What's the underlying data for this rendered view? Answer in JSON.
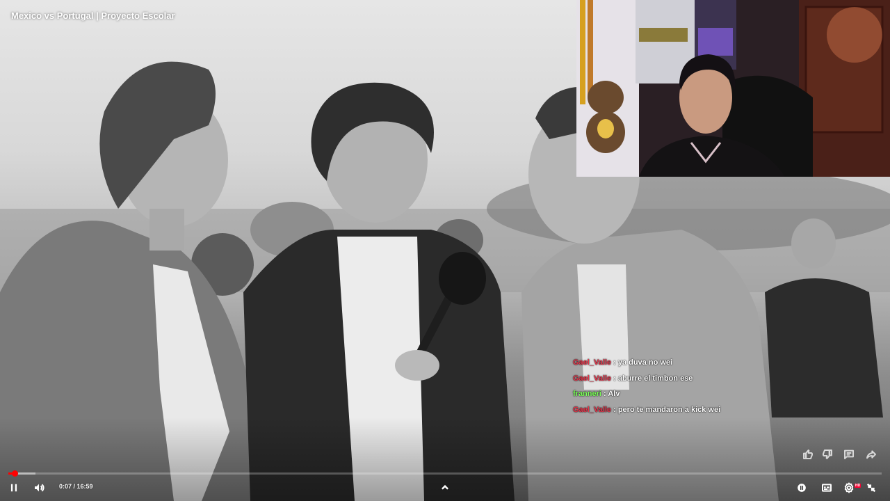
{
  "video": {
    "title": "Mexico vs Portugal | Proyecto Escolar"
  },
  "chat": {
    "messages": [
      {
        "user": "Gael_Valle",
        "text": "ya duva no wei",
        "color": "#e8344a"
      },
      {
        "user": "Gael_Valle",
        "text": "aburre el timbon ese",
        "color": "#e8344a"
      },
      {
        "user": "franneri",
        "text": "Alv",
        "color": "#7dff5a"
      },
      {
        "user": "Gael_Valle",
        "text": "pero te mandaron a kick wei",
        "color": "#e8344a"
      }
    ]
  },
  "player": {
    "current_time": "0:07",
    "duration": "16:59",
    "time_separator": " / ",
    "progress_fraction": 0.0069,
    "buffer_fraction": 0.031,
    "state": "playing",
    "accent_color": "#ff0000",
    "quality_badge": "HD"
  },
  "icons": {
    "play_pause": "pause-icon",
    "volume": "volume-icon",
    "expand": "chevron-up-icon",
    "autoplay": "autoplay-toggle-icon",
    "subtitles": "subtitles-icon",
    "settings": "gear-icon",
    "fullscreen": "exit-fullscreen-icon",
    "like": "thumbs-up-icon",
    "dislike": "thumbs-down-icon",
    "comments": "comment-icon",
    "share": "share-icon"
  }
}
